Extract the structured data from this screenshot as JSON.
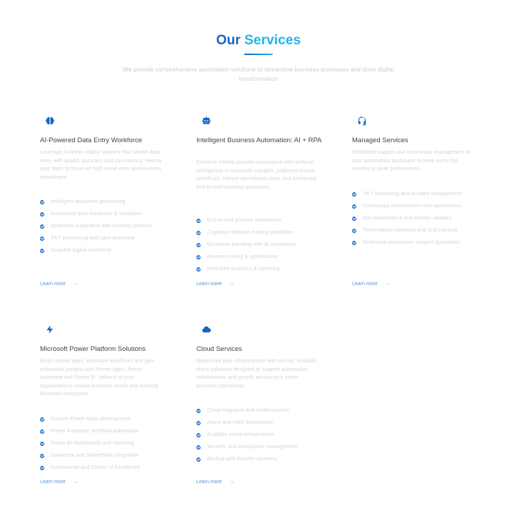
{
  "header": {
    "title_part1": "Our",
    "title_part2": "Services",
    "subtitle": "We provide comprehensive automation solutions to streamline business processes and drive digital transformation"
  },
  "services": [
    {
      "icon": "brain-icon",
      "title": "AI-Powered Data Entry Workforce",
      "description": "Leverage AI-driven digital workers that handle data entry with speed, accuracy and consistency, freeing your team to focus on high-value work across every department.",
      "features": [
        "Intelligent document processing",
        "Automated data extraction & validation",
        "Seamless integration with existing systems",
        "24/7 processing with zero downtime",
        "Scalable digital workforce"
      ],
      "cta": "Learn more",
      "cta_arrow": "→"
    },
    {
      "icon": "robot-icon",
      "title": "Intelligent Business Automation: AI + RPA",
      "description": "Combine robotic process automation with artificial intelligence to automate complex, judgment-based workflows, reduce operational costs and accelerate end-to-end business processes.",
      "features": [
        "End-to-end process automation",
        "Cognitive decision making workflows",
        "Exception handling with AI assistance",
        "Process mining & optimization",
        "Real-time analytics & reporting"
      ],
      "cta": "Learn more",
      "cta_arrow": "→"
    },
    {
      "icon": "headset-icon",
      "title": "Managed Services",
      "description": "Dedicated support and continuous management of your automation landscape to keep every bot running at peak performance.",
      "features": [
        "24/7 monitoring and incident management",
        "Continuous improvement and optimization",
        "Bot maintenance and version updates",
        "Performance reporting and SLA tracking",
        "Dedicated automation support specialists"
      ],
      "cta": "Learn more",
      "cta_arrow": "→"
    },
    {
      "icon": "lightning-icon",
      "title": "Microsoft Power Platform Solutions",
      "description": "Build custom apps, automate workflows and gain actionable insights with Power Apps, Power Automate and Power BI, tailored to your organization's unique business needs and existing Microsoft ecosystem.",
      "features": [
        "Custom Power Apps development",
        "Power Automate workflow automation",
        "Power BI dashboards and reporting",
        "Dataverse and SharePoint integration",
        "Governance and Center of Excellence"
      ],
      "cta": "Learn more",
      "cta_arrow": "→"
    },
    {
      "icon": "cloud-icon",
      "title": "Cloud Services",
      "description": "Modernize your infrastructure with secure, scalable cloud solutions designed to support automation, collaboration and growth across your entire business operations.",
      "features": [
        "Cloud migration and modernization",
        "Azure and AWS deployment",
        "Scalable cloud infrastructure",
        "Security and compliance management",
        "Backup and disaster recovery"
      ],
      "cta": "Learn more",
      "cta_arrow": "→"
    }
  ]
}
